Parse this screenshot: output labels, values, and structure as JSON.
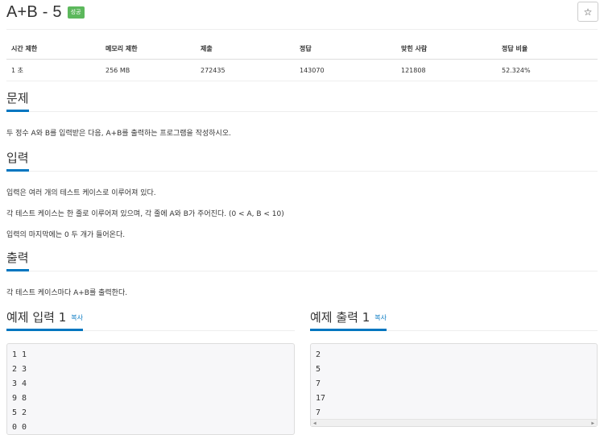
{
  "problem": {
    "title": "A+B - 5",
    "status_badge": "성공",
    "star_icon": "☆"
  },
  "info_table": {
    "headers": [
      "시간 제한",
      "메모리 제한",
      "제출",
      "정답",
      "맞힌 사람",
      "정답 비율"
    ],
    "row": [
      "1 초",
      "256 MB",
      "272435",
      "143070",
      "121808",
      "52.324%"
    ]
  },
  "sections": {
    "problem_heading": "문제",
    "problem_text": "두 정수 A와 B를 입력받은 다음, A+B를 출력하는 프로그램을 작성하시오.",
    "input_heading": "입력",
    "input_lines": [
      "입력은 여러 개의 테스트 케이스로 이루어져 있다.",
      "각 테스트 케이스는 한 줄로 이루어져 있으며, 각 줄에 A와 B가 주어진다. (0 < A, B < 10)",
      "입력의 마지막에는 0 두 개가 들어온다."
    ],
    "output_heading": "출력",
    "output_text": "각 테스트 케이스마다 A+B를 출력한다."
  },
  "examples": {
    "input_heading": "예제 입력 1",
    "output_heading": "예제 출력 1",
    "copy_label": "복사",
    "input_lines": [
      "1 1",
      "2 3",
      "3 4",
      "9 8",
      "5 2",
      "0 0"
    ],
    "output_lines": [
      "2",
      "5",
      "7",
      "17",
      "7"
    ]
  },
  "colors": {
    "accent": "#0076c0",
    "badge": "#5cb85c"
  }
}
